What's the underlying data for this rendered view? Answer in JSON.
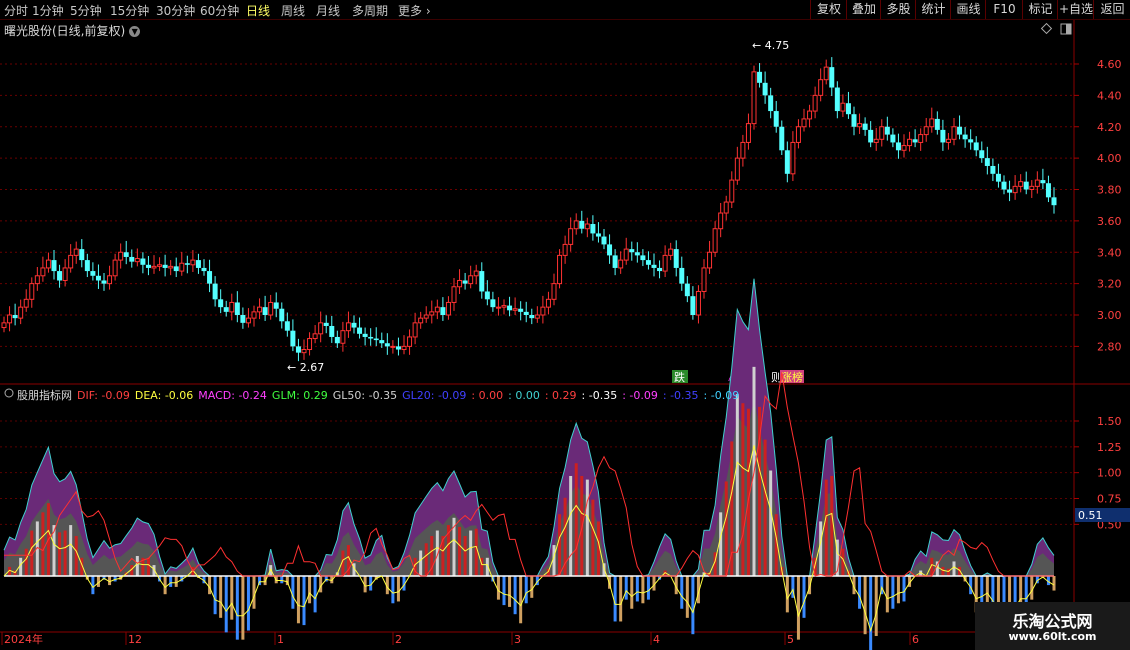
{
  "toolbar": {
    "periods": [
      "分时",
      "1分钟",
      "5分钟",
      "15分钟",
      "30分钟",
      "60分钟",
      "日线",
      "周线",
      "月线",
      "多周期",
      "更多"
    ],
    "active_period": "日线",
    "right_buttons": [
      "复权",
      "叠加",
      "多股",
      "统计",
      "画线",
      "F10",
      "标记",
      "+自选",
      "返回"
    ]
  },
  "stock": {
    "title": "曙光股份(日线,前复权)"
  },
  "main_chart": {
    "y_ticks": [
      "4.60",
      "4.40",
      "4.20",
      "4.00",
      "3.80",
      "3.60",
      "3.40",
      "3.20",
      "3.00",
      "2.80"
    ],
    "high_label": "4.75",
    "low_label": "2.67",
    "marker_die": "跌",
    "marker_zhangbang": "涨榜",
    "marker_prefix": "则",
    "colors": {
      "up": "#ff3232",
      "down": "#54ffff",
      "grid": "#5a0000"
    }
  },
  "indicator": {
    "name": "股朋指标网",
    "items": [
      {
        "label": "DIF: -0.09",
        "color": "#ff4040"
      },
      {
        "label": "DEA: -0.06",
        "color": "#ffff40"
      },
      {
        "label": "MACD: -0.24",
        "color": "#ff40ff"
      },
      {
        "label": "GLM: 0.29",
        "color": "#40ff40"
      },
      {
        "label": "GL50: -0.35",
        "color": "#d0d0d0"
      },
      {
        "label": "GL20: -0.09",
        "color": "#4040ff"
      },
      {
        "label": ": 0.00",
        "color": "#ff4040"
      },
      {
        "label": ": 0.00",
        "color": "#40d0d0"
      },
      {
        "label": ": 0.29",
        "color": "#ff4040"
      },
      {
        "label": ": -0.35",
        "color": "#ffffff"
      },
      {
        "label": ": -0.09",
        "color": "#ff40ff"
      },
      {
        "label": ": -0.35",
        "color": "#4040ff"
      },
      {
        "label": ": -0.09",
        "color": "#40d0ff"
      }
    ],
    "y_ticks": [
      "1.50",
      "1.25",
      "1.00",
      "0.75",
      "0.50"
    ],
    "current_value": "0.51"
  },
  "x_axis": {
    "labels": [
      {
        "text": "2024年",
        "x": 4
      },
      {
        "text": "12",
        "x": 128
      },
      {
        "text": "1",
        "x": 277
      },
      {
        "text": "2",
        "x": 395
      },
      {
        "text": "3",
        "x": 514
      },
      {
        "text": "4",
        "x": 653
      },
      {
        "text": "5",
        "x": 787
      },
      {
        "text": "6",
        "x": 912
      }
    ]
  },
  "watermark": {
    "line1": "乐淘公式网",
    "line2": "www.60lt.com"
  }
}
